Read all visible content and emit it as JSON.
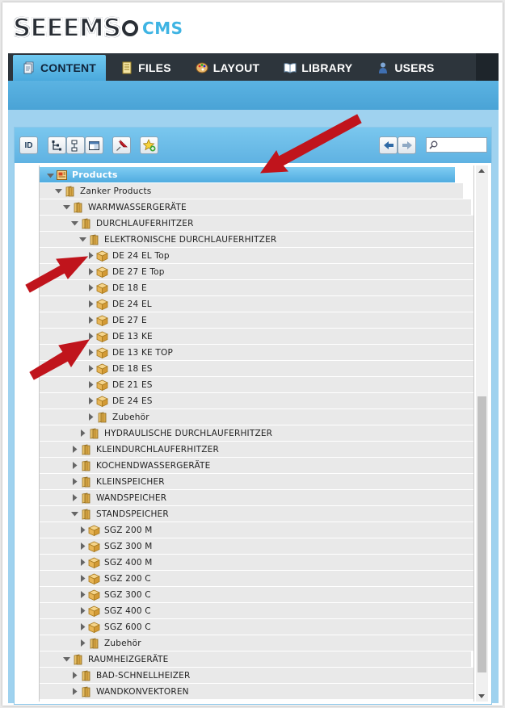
{
  "logo": {
    "word": "SEEEMS",
    "suffix": "CMS"
  },
  "nav": {
    "tabs": [
      {
        "label": "CONTENT",
        "icon": "document-icon",
        "active": true
      },
      {
        "label": "FILES",
        "icon": "files-icon",
        "active": false
      },
      {
        "label": "LAYOUT",
        "icon": "palette-icon",
        "active": false
      },
      {
        "label": "LIBRARY",
        "icon": "book-icon",
        "active": false
      },
      {
        "label": "USERS",
        "icon": "user-icon",
        "active": false
      }
    ]
  },
  "toolbar": {
    "id_label": "ID",
    "search_placeholder": ""
  },
  "tree": {
    "rows": [
      {
        "label": "Products",
        "level": 0,
        "icon": "page",
        "expanded": true,
        "selected": true
      },
      {
        "label": "Zanker Products",
        "level": 1,
        "icon": "folder",
        "expanded": true
      },
      {
        "label": "WARMWASSERGERÄTE",
        "level": 2,
        "icon": "folder",
        "expanded": true
      },
      {
        "label": "DURCHLAUFERHITZER",
        "level": 3,
        "icon": "folder",
        "expanded": true
      },
      {
        "label": "ELEKTRONISCHE DURCHLAUFERHITZER",
        "level": 4,
        "icon": "folder",
        "expanded": true
      },
      {
        "label": "DE 24 EL Top",
        "level": 5,
        "icon": "box",
        "expanded": false
      },
      {
        "label": "DE 27 E Top",
        "level": 5,
        "icon": "box",
        "expanded": false
      },
      {
        "label": "DE 18 E",
        "level": 5,
        "icon": "box",
        "expanded": false
      },
      {
        "label": "DE 24 EL",
        "level": 5,
        "icon": "box",
        "expanded": false
      },
      {
        "label": "DE 27 E",
        "level": 5,
        "icon": "box",
        "expanded": false
      },
      {
        "label": "DE 13 KE",
        "level": 5,
        "icon": "box",
        "expanded": false
      },
      {
        "label": "DE 13 KE TOP",
        "level": 5,
        "icon": "box",
        "expanded": false
      },
      {
        "label": "DE 18 ES",
        "level": 5,
        "icon": "box",
        "expanded": false
      },
      {
        "label": "DE 21 ES",
        "level": 5,
        "icon": "box",
        "expanded": false
      },
      {
        "label": "DE 24 ES",
        "level": 5,
        "icon": "box",
        "expanded": false
      },
      {
        "label": "Zubehör",
        "level": 5,
        "icon": "folder",
        "expanded": false
      },
      {
        "label": "HYDRAULISCHE DURCHLAUFERHITZER",
        "level": 4,
        "icon": "folder",
        "expanded": false
      },
      {
        "label": "KLEINDURCHLAUFERHITZER",
        "level": 3,
        "icon": "folder",
        "expanded": false
      },
      {
        "label": "KOCHENDWASSERGERÄTE",
        "level": 3,
        "icon": "folder",
        "expanded": false
      },
      {
        "label": "KLEINSPEICHER",
        "level": 3,
        "icon": "folder",
        "expanded": false
      },
      {
        "label": "WANDSPEICHER",
        "level": 3,
        "icon": "folder",
        "expanded": false
      },
      {
        "label": "STANDSPEICHER",
        "level": 3,
        "icon": "folder",
        "expanded": true
      },
      {
        "label": "SGZ 200 M",
        "level": 4,
        "icon": "box",
        "expanded": false
      },
      {
        "label": "SGZ 300 M",
        "level": 4,
        "icon": "box",
        "expanded": false
      },
      {
        "label": "SGZ 400 M",
        "level": 4,
        "icon": "box",
        "expanded": false
      },
      {
        "label": "SGZ 200 C",
        "level": 4,
        "icon": "box",
        "expanded": false
      },
      {
        "label": "SGZ 300 C",
        "level": 4,
        "icon": "box",
        "expanded": false
      },
      {
        "label": "SGZ 400 C",
        "level": 4,
        "icon": "box",
        "expanded": false
      },
      {
        "label": "SGZ 600 C",
        "level": 4,
        "icon": "box",
        "expanded": false
      },
      {
        "label": "Zubehör",
        "level": 4,
        "icon": "folder",
        "expanded": false
      },
      {
        "label": "RAUMHEIZGERÄTE",
        "level": 2,
        "icon": "folder",
        "expanded": true
      },
      {
        "label": "BAD-SCHNELLHEIZER",
        "level": 3,
        "icon": "folder",
        "expanded": false
      },
      {
        "label": "WANDKONVEKTOREN",
        "level": 3,
        "icon": "folder",
        "expanded": false
      }
    ]
  },
  "colors": {
    "accent": "#4aa9dc",
    "annotation_arrow": "#c0141c"
  }
}
